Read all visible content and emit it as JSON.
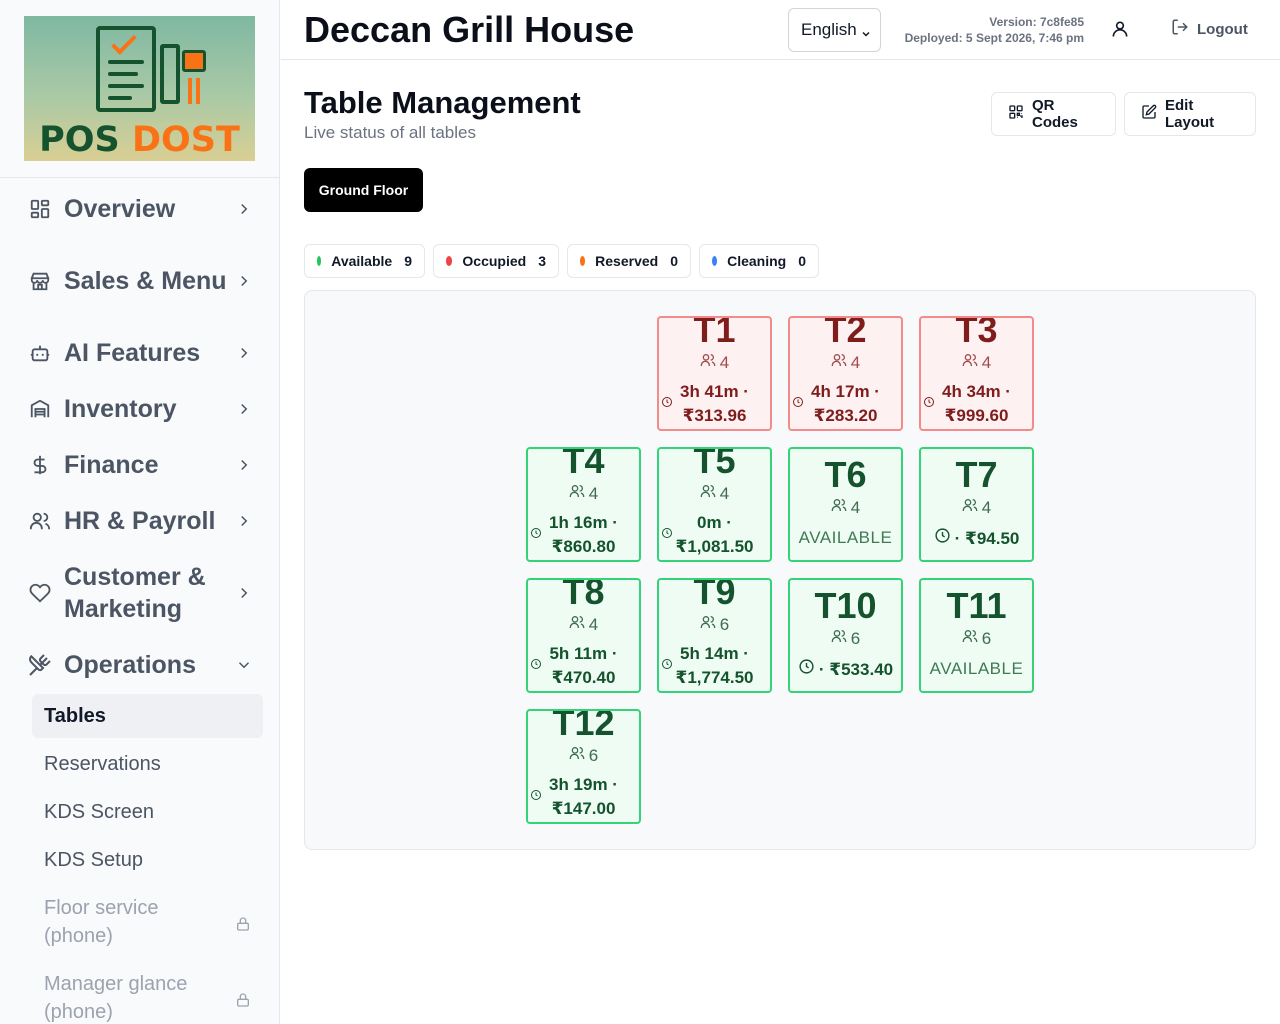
{
  "header": {
    "brand": "Deccan Grill House",
    "language": "English",
    "version": "Version: 7c8fe85",
    "deployed": "Deployed: 5 Sept 2026, 7:46 pm",
    "logout": "Logout"
  },
  "logo": {
    "word1": "POS",
    "word2": "DOST"
  },
  "sidebar": {
    "items": [
      {
        "label": "Overview",
        "icon": "grid-icon"
      },
      {
        "label": "Sales & Menu",
        "icon": "store-icon"
      },
      {
        "label": "AI Features",
        "icon": "bot-icon"
      },
      {
        "label": "Inventory",
        "icon": "warehouse-icon"
      },
      {
        "label": "Finance",
        "icon": "dollar-icon"
      },
      {
        "label": "HR & Payroll",
        "icon": "users-icon"
      },
      {
        "label": "Customer & Marketing",
        "icon": "heart-icon"
      },
      {
        "label": "Operations",
        "icon": "utensils-icon"
      }
    ],
    "sub_items": [
      {
        "label": "Tables",
        "active": true
      },
      {
        "label": "Reservations"
      },
      {
        "label": "KDS Screen"
      },
      {
        "label": "KDS Setup"
      },
      {
        "label": "Floor service (phone)",
        "locked": true
      },
      {
        "label": "Manager glance (phone)",
        "locked": true
      }
    ]
  },
  "main": {
    "title": "Table Management",
    "subtitle": "Live status of all tables",
    "qr_button": "QR Codes",
    "edit_button": "Edit Layout",
    "floor_tab": "Ground Floor",
    "legend": [
      {
        "label": "Available",
        "count": "9",
        "color": "#22c55e"
      },
      {
        "label": "Occupied",
        "count": "3",
        "color": "#ef4444"
      },
      {
        "label": "Reserved",
        "count": "0",
        "color": "#f97316"
      },
      {
        "label": "Cleaning",
        "count": "0",
        "color": "#3b82f6"
      }
    ]
  },
  "tables": [
    {
      "name": "T1",
      "seats": "4",
      "status": "occupied",
      "time": "3h 41m ·",
      "amount": "₹313.96"
    },
    {
      "name": "T2",
      "seats": "4",
      "status": "occupied",
      "time": "4h 17m ·",
      "amount": "₹283.20"
    },
    {
      "name": "T3",
      "seats": "4",
      "status": "occupied",
      "time": "4h 34m ·",
      "amount": "₹999.60"
    },
    {
      "name": "T4",
      "seats": "4",
      "status": "available",
      "time": "1h 16m ·",
      "amount": "₹860.80"
    },
    {
      "name": "T5",
      "seats": "4",
      "status": "available",
      "time": "0m ·",
      "amount": "₹1,081.50"
    },
    {
      "name": "T6",
      "seats": "4",
      "status": "available",
      "label": "AVAILABLE"
    },
    {
      "name": "T7",
      "seats": "4",
      "status": "available",
      "amount_inline": "· ₹94.50"
    },
    {
      "name": "T8",
      "seats": "4",
      "status": "available",
      "time": "5h 11m ·",
      "amount": "₹470.40"
    },
    {
      "name": "T9",
      "seats": "6",
      "status": "available",
      "time": "5h 14m ·",
      "amount": "₹1,774.50"
    },
    {
      "name": "T10",
      "seats": "6",
      "status": "available",
      "amount_inline": "· ₹533.40"
    },
    {
      "name": "T11",
      "seats": "6",
      "status": "available",
      "label": "AVAILABLE"
    },
    {
      "name": "T12",
      "seats": "6",
      "status": "available",
      "time": "3h 19m ·",
      "amount": "₹147.00"
    }
  ]
}
